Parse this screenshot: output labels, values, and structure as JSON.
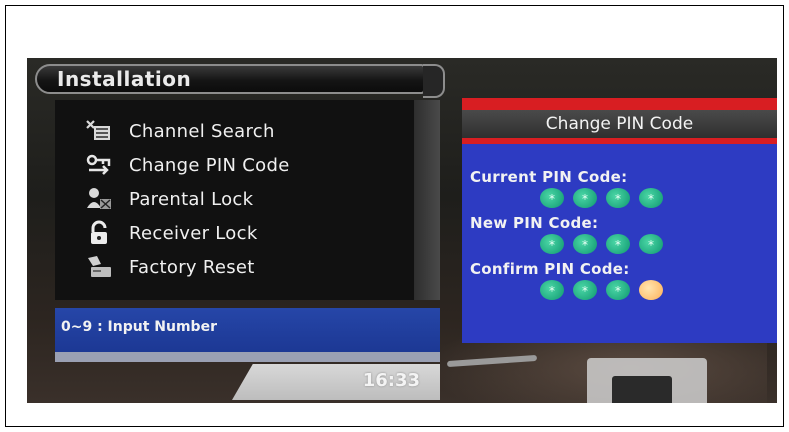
{
  "header": {
    "title": "Installation"
  },
  "menu": {
    "items": [
      {
        "label": "Channel Search",
        "icon": "channel-search-icon"
      },
      {
        "label": "Change PIN Code",
        "icon": "change-pin-icon"
      },
      {
        "label": "Parental Lock",
        "icon": "parental-lock-icon"
      },
      {
        "label": "Receiver Lock",
        "icon": "padlock-icon"
      },
      {
        "label": "Factory Reset",
        "icon": "factory-reset-icon"
      }
    ]
  },
  "hint": {
    "text": "0~9 : Input Number"
  },
  "clock": {
    "time": "16:33"
  },
  "pin_panel": {
    "title": "Change PIN Code",
    "current_label": "Current PIN Code:",
    "new_label": "New PIN Code:",
    "confirm_label": "Confirm PIN Code:",
    "mask_char": "*",
    "current_entered": 4,
    "new_entered": 4,
    "confirm_entered": 3
  },
  "colors": {
    "panel_blue": "#2d3bc2",
    "header_red": "#d81e22",
    "dot_green": "#1aa47a",
    "dot_active": "#ffb864",
    "hint_blue": "#2646a8"
  }
}
